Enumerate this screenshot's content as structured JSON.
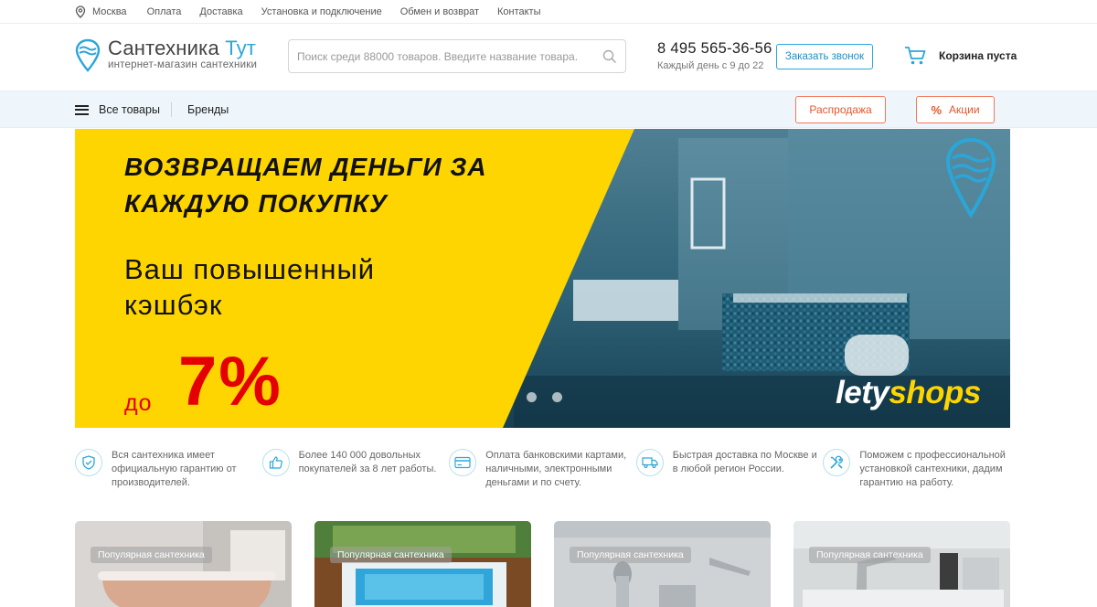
{
  "topbar": {
    "city": "Москва",
    "links": [
      "Оплата",
      "Доставка",
      "Установка и подключение",
      "Обмен и возврат",
      "Контакты"
    ]
  },
  "header": {
    "logo_name": "Сантехника",
    "logo_name_accent": "Тут",
    "logo_sub": "интернет-магазин сантехники",
    "search_placeholder": "Поиск среди 88000 товаров. Введите название товара.",
    "phone": "8 495 565-36-56",
    "phone_hours": "Каждый день с 9 до 22",
    "call_button": "Заказать звонок",
    "cart_label": "Корзина пуста"
  },
  "nav": {
    "all_goods": "Все товары",
    "brands": "Бренды",
    "sale": "Распродажа",
    "promo_icon": "%",
    "promo": "Акции"
  },
  "banner": {
    "headline": "ВОЗВРАЩАЕМ ДЕНЬГИ ЗА КАЖДУЮ ПОКУПКУ",
    "subline": "Ваш повышенный кэшбэк",
    "prefix": "до",
    "percent": "7%",
    "partner_a": "lety",
    "partner_b": "shops",
    "slides": 2
  },
  "features": [
    {
      "icon": "shield-icon",
      "text": "Вся сантехника имеет официальную гарантию от производителей."
    },
    {
      "icon": "thumbs-up-icon",
      "text": "Более 140 000 довольных покупателей за 8 лет работы."
    },
    {
      "icon": "card-payment-icon",
      "text": "Оплата банковскими картами, наличными, электронными деньгами и по счету."
    },
    {
      "icon": "delivery-truck-icon",
      "text": "Быстрая доставка по Москве и в любой регион России."
    },
    {
      "icon": "tools-icon",
      "text": "Поможем с профессиональной установкой сантехники, дадим гарантию на работу."
    }
  ],
  "cards": [
    {
      "badge": "Популярная сантехника"
    },
    {
      "badge": "Популярная сантехника"
    },
    {
      "badge": "Популярная сантехника"
    },
    {
      "badge": "Популярная сантехника"
    }
  ],
  "colors": {
    "accent": "#2ba6d9",
    "sale": "#e4572e",
    "banner_yellow": "#ffd500",
    "banner_red": "#e40000"
  }
}
